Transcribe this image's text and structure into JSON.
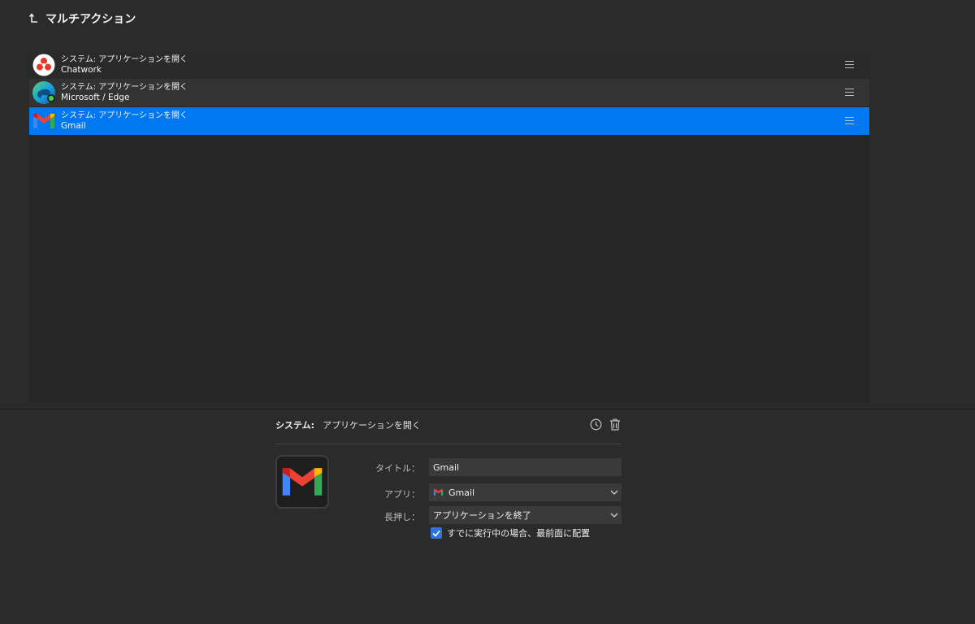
{
  "header": {
    "title": "マルチアクション",
    "back_icon": "back-arrow-icon"
  },
  "actions": [
    {
      "type": "システム: アプリケーションを開く",
      "name": "Chatwork",
      "icon": "chatwork-icon"
    },
    {
      "type": "システム: アプリケーションを開く",
      "name": "Microsoft / Edge",
      "icon": "edge-icon"
    },
    {
      "type": "システム: アプリケーションを開く",
      "name": "Gmail",
      "icon": "gmail-icon"
    }
  ],
  "selected_index": 2,
  "detail": {
    "category": "システム:",
    "action": "アプリケーションを開く",
    "title_label": "タイトル：",
    "title_value": "Gmail",
    "app_label": "アプリ：",
    "app_value": "Gmail",
    "longpress_label": "長押し：",
    "longpress_value": "アプリケーションを終了",
    "checkbox_label": "すでに実行中の場合、最前面に配置",
    "checkbox_checked": true
  },
  "colors": {
    "selected_row": "#0078f2",
    "checkbox": "#2f74d8",
    "background": "#2b2b2b"
  }
}
